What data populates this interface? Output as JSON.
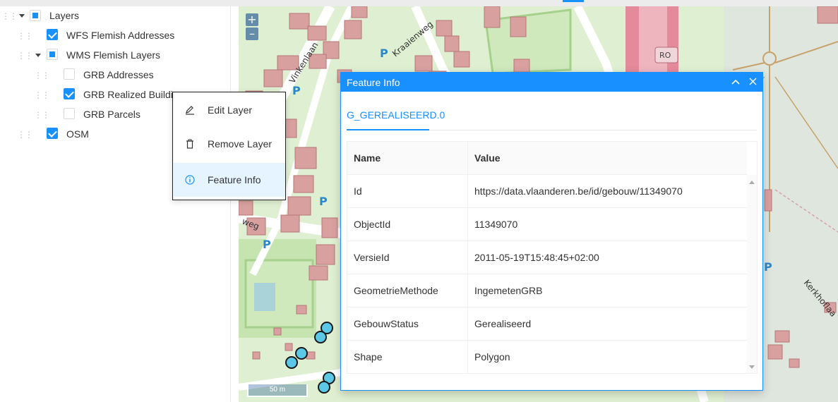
{
  "layer_tree": {
    "root": {
      "label": "Layers",
      "state": "indeterminate",
      "expanded": true
    },
    "items": [
      {
        "label": "WFS Flemish Addresses",
        "state": "checked"
      },
      {
        "label": "WMS Flemish Layers",
        "state": "indeterminate",
        "expanded": true
      },
      {
        "label": "GRB Addresses",
        "state": "unchecked"
      },
      {
        "label": "GRB Realized Buildin",
        "state": "checked"
      },
      {
        "label": "GRB Parcels",
        "state": "unchecked"
      },
      {
        "label": "OSM",
        "state": "checked"
      }
    ]
  },
  "context_menu": {
    "items": [
      {
        "label": "Edit Layer",
        "icon": "edit-icon"
      },
      {
        "label": "Remove Layer",
        "icon": "trash-icon"
      },
      {
        "label": "Feature Info",
        "icon": "info-icon",
        "active": true
      }
    ]
  },
  "map": {
    "zoom_in": "+",
    "zoom_out": "–",
    "scale_label": "50 m",
    "labels": [
      "Vinkenlaan",
      "Kraaienweg",
      "RO",
      "Kerkhoflaa",
      "weg"
    ]
  },
  "feature_info": {
    "title": "Feature Info",
    "collapse_icon": "chevron-up-icon",
    "close_icon": "close-icon",
    "tab": "G_GEREALISEERD.0",
    "columns": [
      "Name",
      "Value"
    ],
    "rows": [
      {
        "name": "Id",
        "value": "https://data.vlaanderen.be/id/gebouw/11349070"
      },
      {
        "name": "ObjectId",
        "value": "11349070"
      },
      {
        "name": "VersieId",
        "value": "2011-05-19T15:48:45+02:00"
      },
      {
        "name": "GeometrieMethode",
        "value": "IngemetenGRB"
      },
      {
        "name": "GebouwStatus",
        "value": "Gerealiseerd"
      },
      {
        "name": "Shape",
        "value": "Polygon"
      }
    ]
  },
  "colors": {
    "accent": "#1890ff",
    "building": "#d9a0a0",
    "park": "#c8e6b4",
    "road": "#ffffff",
    "motorway": "#e58a9a"
  }
}
